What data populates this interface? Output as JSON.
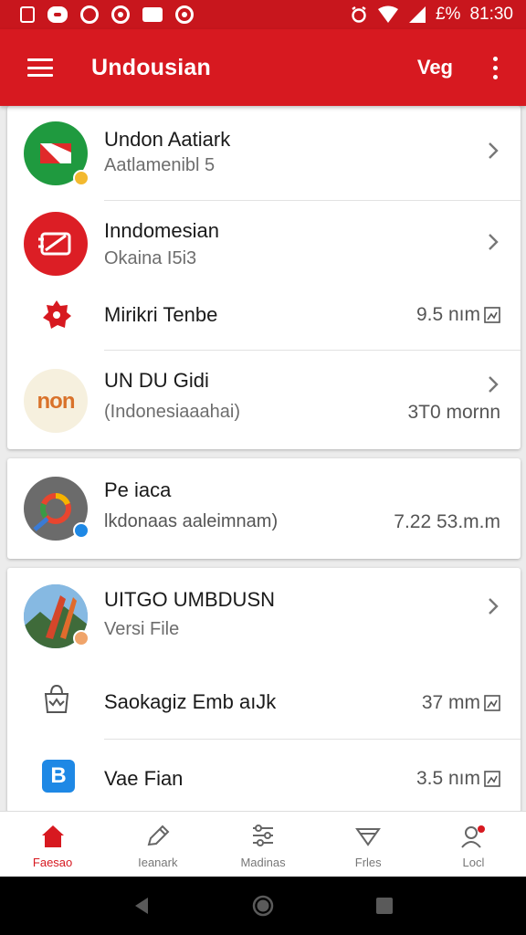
{
  "status_bar": {
    "battery_text": "£%",
    "time": "81:30"
  },
  "app_bar": {
    "title": "Undousian",
    "action_label": "Veg"
  },
  "card1": {
    "items": [
      {
        "title": "Undon Aatiark",
        "subtitle": "Aatlamenibl 5"
      },
      {
        "title": "Inndomesian",
        "subtitle": "Okaina I5i3"
      },
      {
        "title": "Mirikri Tenbe",
        "meta": "9.5 nım"
      },
      {
        "title": "UN DU Gidi",
        "subtitle": "(Indonesiaaahai)",
        "meta": "3T0 mornn",
        "logo_text": "non"
      }
    ]
  },
  "card2": {
    "title": "Pe iaca",
    "subtitle": "lkdonaas aaleimnam)",
    "meta": "7.22 53.m.m"
  },
  "card3": {
    "items": [
      {
        "title": "UITGO UMBDUSN",
        "subtitle": "Versi File"
      },
      {
        "title": "Saokagiz Emb aıJk",
        "meta": "37 mm"
      },
      {
        "title": "Vae Fian",
        "meta": "3.5 nım",
        "logo_text": "B"
      }
    ]
  },
  "bottom_nav": [
    {
      "label": "Faesao",
      "icon": "home-icon",
      "active": true
    },
    {
      "label": "Ieanark",
      "icon": "pen-icon",
      "active": false
    },
    {
      "label": "Madinas",
      "icon": "filter-list-icon",
      "active": false
    },
    {
      "label": "Frles",
      "icon": "funnel-icon",
      "active": false
    },
    {
      "label": "Locl",
      "icon": "profile-icon",
      "active": false
    }
  ],
  "colors": {
    "brand": "#d71920",
    "status_bar": "#c8161d"
  }
}
